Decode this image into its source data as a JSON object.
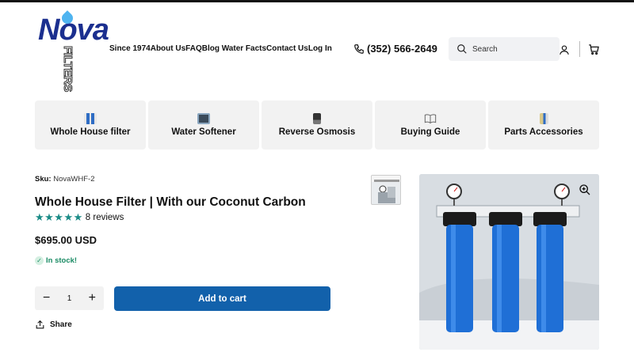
{
  "brand": {
    "name": "Nova",
    "sub": "FILTERS",
    "colors": {
      "primary": "#1b2f8f",
      "accent": "#4fb4f0"
    }
  },
  "nav": [
    "Since 1974",
    "About Us",
    "FAQ",
    "Blog Water Facts",
    "Contact Us",
    "Log In"
  ],
  "phone": "(352) 566-2649",
  "search": {
    "placeholder": "Search"
  },
  "categories": [
    {
      "label": "Whole House filter",
      "icon": "filter-thumb-icon"
    },
    {
      "label": "Water Softener",
      "icon": "softener-thumb-icon"
    },
    {
      "label": "Reverse Osmosis",
      "icon": "ro-thumb-icon"
    },
    {
      "label": "Buying Guide",
      "icon": "book-icon"
    },
    {
      "label": "Parts Accessories",
      "icon": "parts-thumb-icon"
    }
  ],
  "product": {
    "sku_label": "Sku:",
    "sku": "NovaWHF-2",
    "title": "Whole House Filter | With our Coconut Carbon",
    "rating": 5,
    "stars": "★★★★★",
    "reviews": "8 reviews",
    "price": "$695.00 USD",
    "stock": "In stock!",
    "quantity": "1",
    "add_to_cart": "Add to cart",
    "share": "Share"
  },
  "colors": {
    "button": "#1261ab",
    "stars": "#1a8b86",
    "stock": "#1a8b64"
  }
}
